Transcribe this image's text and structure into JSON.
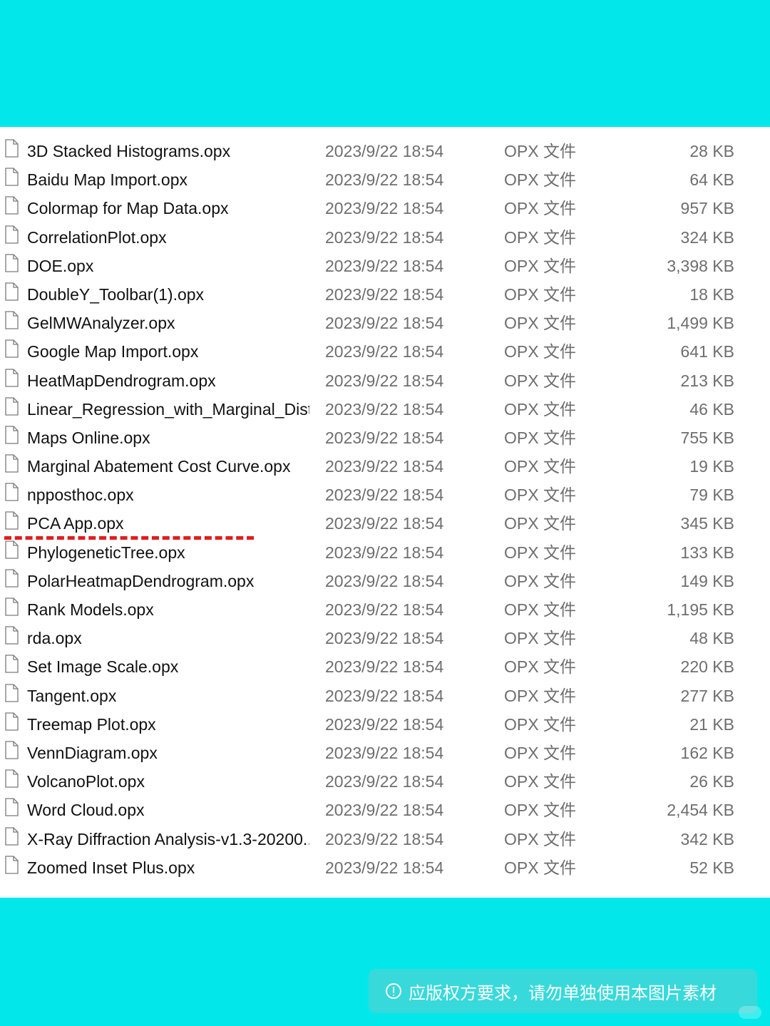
{
  "files": [
    {
      "name": "3D Stacked Histograms.opx",
      "date": "2023/9/22 18:54",
      "type": "OPX 文件",
      "size": "28 KB"
    },
    {
      "name": "Baidu Map Import.opx",
      "date": "2023/9/22 18:54",
      "type": "OPX 文件",
      "size": "64 KB"
    },
    {
      "name": "Colormap for Map Data.opx",
      "date": "2023/9/22 18:54",
      "type": "OPX 文件",
      "size": "957 KB"
    },
    {
      "name": "CorrelationPlot.opx",
      "date": "2023/9/22 18:54",
      "type": "OPX 文件",
      "size": "324 KB"
    },
    {
      "name": "DOE.opx",
      "date": "2023/9/22 18:54",
      "type": "OPX 文件",
      "size": "3,398 KB"
    },
    {
      "name": "DoubleY_Toolbar(1).opx",
      "date": "2023/9/22 18:54",
      "type": "OPX 文件",
      "size": "18 KB"
    },
    {
      "name": "GelMWAnalyzer.opx",
      "date": "2023/9/22 18:54",
      "type": "OPX 文件",
      "size": "1,499 KB"
    },
    {
      "name": "Google Map Import.opx",
      "date": "2023/9/22 18:54",
      "type": "OPX 文件",
      "size": "641 KB"
    },
    {
      "name": "HeatMapDendrogram.opx",
      "date": "2023/9/22 18:54",
      "type": "OPX 文件",
      "size": "213 KB"
    },
    {
      "name": "Linear_Regression_with_Marginal_Dist...",
      "date": "2023/9/22 18:54",
      "type": "OPX 文件",
      "size": "46 KB"
    },
    {
      "name": "Maps Online.opx",
      "date": "2023/9/22 18:54",
      "type": "OPX 文件",
      "size": "755 KB"
    },
    {
      "name": "Marginal Abatement Cost Curve.opx",
      "date": "2023/9/22 18:54",
      "type": "OPX 文件",
      "size": "19 KB"
    },
    {
      "name": "npposthoc.opx",
      "date": "2023/9/22 18:54",
      "type": "OPX 文件",
      "size": "79 KB"
    },
    {
      "name": "PCA App.opx",
      "date": "2023/9/22 18:54",
      "type": "OPX 文件",
      "size": "345 KB"
    },
    {
      "name": "PhylogeneticTree.opx",
      "date": "2023/9/22 18:54",
      "type": "OPX 文件",
      "size": "133 KB"
    },
    {
      "name": "PolarHeatmapDendrogram.opx",
      "date": "2023/9/22 18:54",
      "type": "OPX 文件",
      "size": "149 KB"
    },
    {
      "name": "Rank Models.opx",
      "date": "2023/9/22 18:54",
      "type": "OPX 文件",
      "size": "1,195 KB"
    },
    {
      "name": "rda.opx",
      "date": "2023/9/22 18:54",
      "type": "OPX 文件",
      "size": "48 KB"
    },
    {
      "name": "Set Image Scale.opx",
      "date": "2023/9/22 18:54",
      "type": "OPX 文件",
      "size": "220 KB"
    },
    {
      "name": "Tangent.opx",
      "date": "2023/9/22 18:54",
      "type": "OPX 文件",
      "size": "277 KB"
    },
    {
      "name": "Treemap Plot.opx",
      "date": "2023/9/22 18:54",
      "type": "OPX 文件",
      "size": "21 KB"
    },
    {
      "name": "VennDiagram.opx",
      "date": "2023/9/22 18:54",
      "type": "OPX 文件",
      "size": "162 KB"
    },
    {
      "name": "VolcanoPlot.opx",
      "date": "2023/9/22 18:54",
      "type": "OPX 文件",
      "size": "26 KB"
    },
    {
      "name": "Word Cloud.opx",
      "date": "2023/9/22 18:54",
      "type": "OPX 文件",
      "size": "2,454 KB"
    },
    {
      "name": "X-Ray Diffraction Analysis-v1.3-20200...",
      "date": "2023/9/22 18:54",
      "type": "OPX 文件",
      "size": "342 KB"
    },
    {
      "name": "Zoomed Inset Plus.opx",
      "date": "2023/9/22 18:54",
      "type": "OPX 文件",
      "size": "52 KB"
    }
  ],
  "notice": {
    "icon": "info-circle-icon",
    "text": "应版权方要求，请勿单独使用本图片素材"
  },
  "colors": {
    "background": "#02E8EA",
    "marker": "#E01E1E",
    "notice_bg": "#38D9DB"
  }
}
